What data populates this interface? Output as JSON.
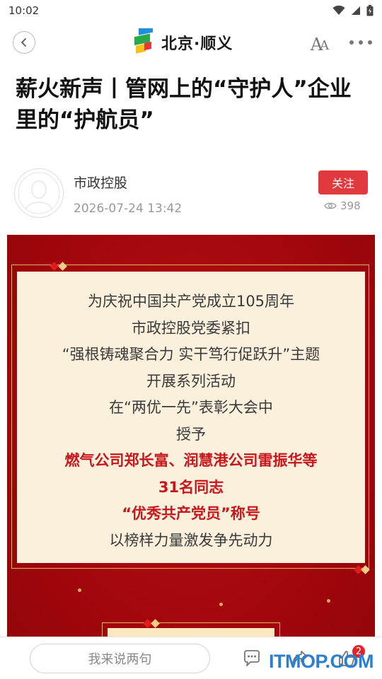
{
  "status_bar": {
    "time": "10:02"
  },
  "header": {
    "logo_text": "北京·顺义"
  },
  "article": {
    "title": "薪火新声丨管网上的“守护人”企业里的“护航员”",
    "author": "市政控股",
    "publish_time": "2026-07-24 13:42",
    "follow_label": "关注",
    "view_count": "398"
  },
  "poster": {
    "lines": [
      {
        "text": "为庆祝中国共产党成立105周年",
        "highlight": false
      },
      {
        "text": "市政控股党委紧扣",
        "highlight": false
      },
      {
        "text": "“强根铸魂聚合力 实干笃行促跃升”主题",
        "highlight": false
      },
      {
        "text": "开展系列活动",
        "highlight": false
      },
      {
        "text": "在“两优一先”表彰大会中",
        "highlight": false
      },
      {
        "text": "授予",
        "highlight": false
      },
      {
        "text": "燃气公司郑长富、润慧港公司雷振华等",
        "highlight": true
      },
      {
        "text": "31名同志",
        "highlight": true
      },
      {
        "text": "“优秀共产党员”称号",
        "highlight": true
      },
      {
        "text": "以榜样力量激发争先动力",
        "highlight": false
      }
    ],
    "highlight_color": "#c8161d",
    "background_color": "#a2070c"
  },
  "bottom_bar": {
    "comment_placeholder": "我来说两句",
    "like_badge": "2"
  },
  "watermark": "ITMOP.COM",
  "colors": {
    "accent": "#e0393e",
    "watermark": "#2b7fd1"
  }
}
